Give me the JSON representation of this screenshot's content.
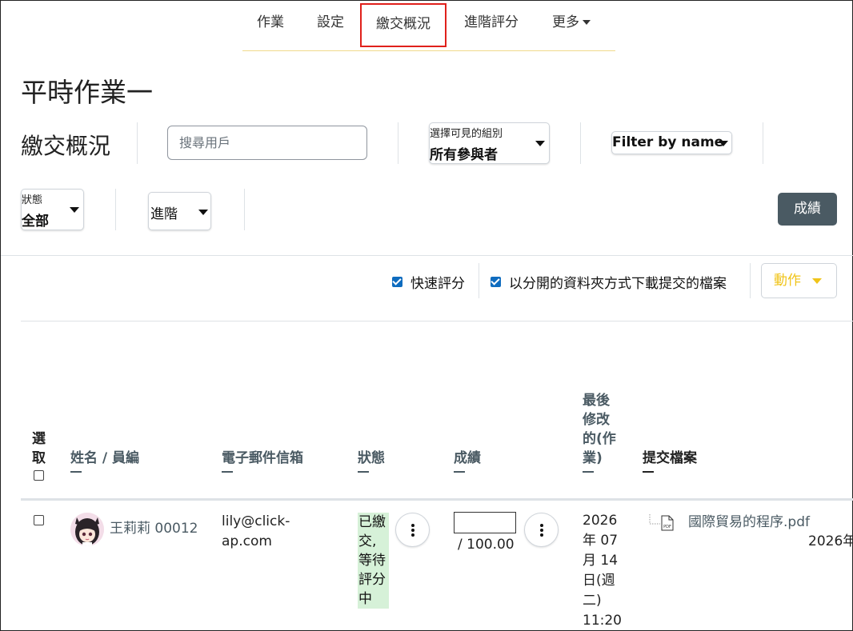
{
  "nav": {
    "tabs": [
      "作業",
      "設定",
      "繳交概況",
      "進階評分",
      "更多"
    ],
    "active": "繳交概況"
  },
  "page_title": "平時作業一",
  "section_title": "繳交概況",
  "search": {
    "placeholder": "搜尋用戶"
  },
  "group_select": {
    "label": "選擇可見的組別",
    "value": "所有參與者"
  },
  "filter_by_name": {
    "label": "Filter by name"
  },
  "status_select": {
    "label": "狀態",
    "value": "全部"
  },
  "advanced_select": {
    "value": "進階"
  },
  "grade_button": "成績",
  "options": {
    "quick_grading": "快速評分",
    "download_folders": "以分開的資料夾方式下載提交的檔案"
  },
  "action_button": "動作",
  "table": {
    "headers": {
      "select_line1": "選",
      "select_line2": "取",
      "name": "姓名 / 員編",
      "email": "電子郵件信箱",
      "status": "狀態",
      "grade": "成績",
      "modified_lines": [
        "最後",
        "修改",
        "的(作",
        "業)"
      ],
      "files": "提交檔案"
    },
    "rows": [
      {
        "name": "王莉莉 00012",
        "email_lines": [
          "lily@click-",
          "ap.com"
        ],
        "status_lines": [
          "已繳",
          "交,",
          "等待",
          "評分",
          "中"
        ],
        "grade_max": "/ 100.00",
        "modified_lines": [
          "2026",
          "年 07",
          "月 14",
          "日(週",
          "二)",
          "11:20"
        ],
        "file_name": "國際貿易的程序.pdf",
        "file_date": "2026年"
      }
    ]
  },
  "colors": {
    "active_tab_border": "#e0201b",
    "grade_button_bg": "#4a5a63",
    "checkbox_blue": "#0f6cbf",
    "action_text": "#f0c419",
    "status_badge_bg": "#d6f1d8"
  },
  "icons": [
    "caret-down-icon",
    "pdf-file-icon",
    "kebab-menu-icon",
    "checkbox-checked",
    "checkbox-unchecked"
  ]
}
